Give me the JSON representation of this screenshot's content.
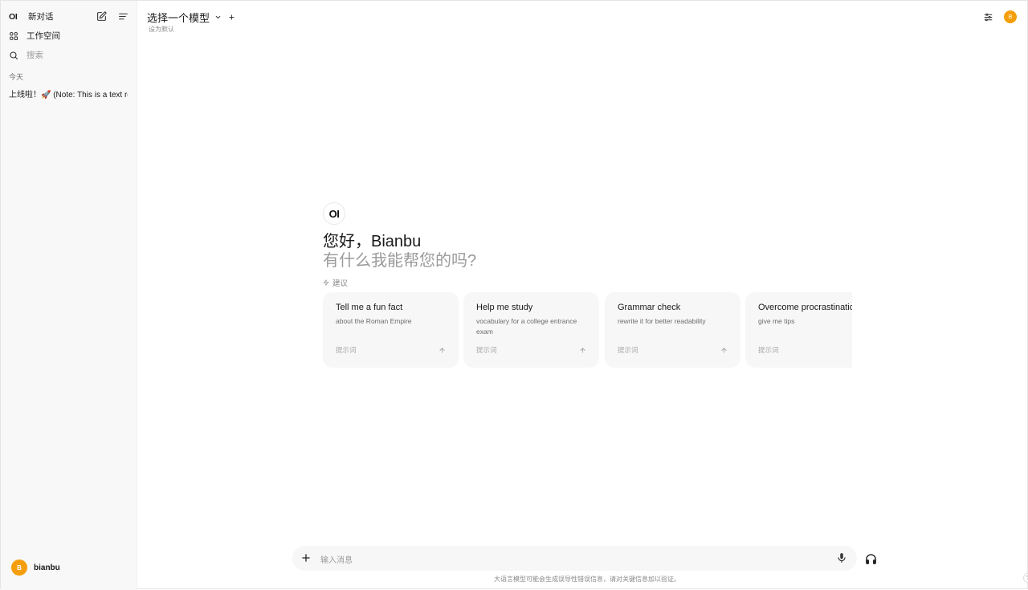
{
  "sidebar": {
    "logo": "OI",
    "new_chat_label": "新对话",
    "workspace_label": "工作空间",
    "search_placeholder": "搜索",
    "section_today": "今天",
    "chats": [
      "上线啦！🚀 (Note: This is a text re"
    ],
    "user": {
      "initial": "B",
      "name": "bianbu"
    }
  },
  "header": {
    "model_select_label": "选择一个模型",
    "set_default_label": "设为默认",
    "avatar_initial": "B"
  },
  "welcome": {
    "logo": "OI",
    "greeting": "您好，Bianbu",
    "subtitle": "有什么我能帮您的吗?",
    "suggestions_label": "建议"
  },
  "suggestions": [
    {
      "title": "Tell me a fun fact",
      "subtitle": "about the Roman Empire",
      "footer": "提示词"
    },
    {
      "title": "Help me study",
      "subtitle": "vocabulary for a college entrance exam",
      "footer": "提示词"
    },
    {
      "title": "Grammar check",
      "subtitle": "rewrite it for better readability",
      "footer": "提示词"
    },
    {
      "title": "Overcome procrastination",
      "subtitle": "give me tips",
      "footer": "提示词"
    }
  ],
  "input": {
    "placeholder": "输入消息",
    "disclaimer": "大语言模型可能会生成误导性错误信息，请对关键信息加以验证。",
    "help": "?"
  },
  "colors": {
    "accent": "#f59e0b",
    "sidebar_bg": "#f8f8f8",
    "card_bg": "#f7f7f7"
  }
}
